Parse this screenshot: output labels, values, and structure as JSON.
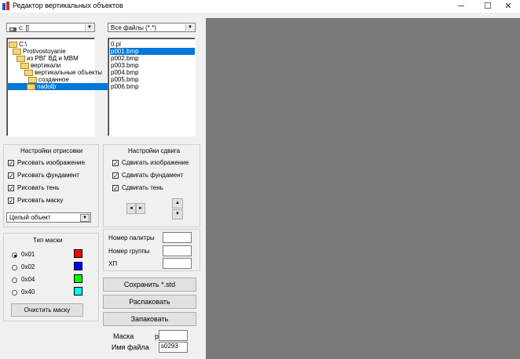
{
  "window": {
    "title": "Редактор вертикальных объектов",
    "minimize": "─",
    "maximize": "☐",
    "close": "✕"
  },
  "drive": {
    "value": "c: []"
  },
  "filter": {
    "value": "Все файлы (*.*)"
  },
  "tree": [
    {
      "label": "C:\\",
      "selected": false
    },
    {
      "label": "Protivostoyanie",
      "selected": false
    },
    {
      "label": "из РВГ ВД и МВМ",
      "selected": false
    },
    {
      "label": "вертикали",
      "selected": false
    },
    {
      "label": "вертикальные объекты",
      "selected": false
    },
    {
      "label": "созданное",
      "selected": false
    },
    {
      "label": "nadolb",
      "selected": true
    }
  ],
  "files": [
    {
      "label": "0.pl",
      "selected": false
    },
    {
      "label": "p001.bmp",
      "selected": true
    },
    {
      "label": "p002.bmp",
      "selected": false
    },
    {
      "label": "p003.bmp",
      "selected": false
    },
    {
      "label": "p004.bmp",
      "selected": false
    },
    {
      "label": "p005.bmp",
      "selected": false
    },
    {
      "label": "p006.bmp",
      "selected": false
    }
  ],
  "render_settings": {
    "title": "Настройки отрисовки",
    "options": [
      {
        "label": "Рисовать изображение",
        "checked": true
      },
      {
        "label": "Рисовать фундамент",
        "checked": true
      },
      {
        "label": "Рисовать тень",
        "checked": true
      },
      {
        "label": "Рисовать маску",
        "checked": true
      }
    ],
    "mode": "Целый объект"
  },
  "shift_settings": {
    "title": "Настройки сдвига",
    "options": [
      {
        "label": "Сдвигать изображение",
        "checked": true
      },
      {
        "label": "Сдвигать фундамент",
        "checked": true
      },
      {
        "label": "Сдвигать тень",
        "checked": true
      }
    ],
    "left": "◄",
    "right": "►",
    "up": "▲",
    "down": "▼"
  },
  "mask_type": {
    "title": "Тип маски",
    "options": [
      {
        "label": "0x01",
        "checked": true,
        "color": "#ff0000"
      },
      {
        "label": "0x02",
        "checked": false,
        "color": "#0000ff"
      },
      {
        "label": "0x04",
        "checked": false,
        "color": "#00ff00"
      },
      {
        "label": "0x40",
        "checked": false,
        "color": "#00ffff"
      }
    ],
    "clear_button": "Очистить маску"
  },
  "info": {
    "palette_label": "Номер палитры",
    "palette_value": "",
    "group_label": "Номер группы",
    "group_value": "",
    "hp_label": "ХП",
    "hp_value": ""
  },
  "actions": {
    "save": "Сохранить *.std",
    "unpack": "Распаковать",
    "pack": "Запаковать"
  },
  "mask": {
    "label": "Маска",
    "value": "p"
  },
  "filename": {
    "label": "Имя файла",
    "value": "s0293"
  }
}
